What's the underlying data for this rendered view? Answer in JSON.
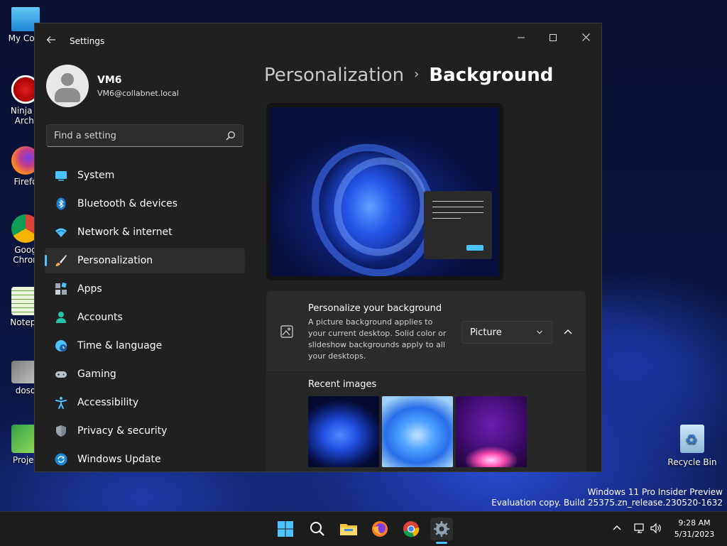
{
  "desktop": {
    "icons": [
      "My Com",
      "Ninja K\nArchi",
      "Firefo",
      "Goog\nChron",
      "Notepa",
      "doso",
      "Projec"
    ],
    "recycle_bin": "Recycle Bin",
    "watermark_line1": "Windows 11 Pro Insider Preview",
    "watermark_line2": "Evaluation copy. Build 25375.zn_release.230520-1632"
  },
  "window": {
    "title": "Settings",
    "controls": {
      "minimize": "—",
      "maximize": "☐",
      "close": "✕"
    }
  },
  "profile": {
    "name": "VM6",
    "email": "VM6@collabnet.local"
  },
  "search": {
    "placeholder": "Find a setting"
  },
  "sidebar": {
    "items": [
      {
        "label": "System",
        "icon": "monitor-icon"
      },
      {
        "label": "Bluetooth & devices",
        "icon": "bluetooth-icon"
      },
      {
        "label": "Network & internet",
        "icon": "wifi-icon"
      },
      {
        "label": "Personalization",
        "icon": "brush-icon",
        "active": true
      },
      {
        "label": "Apps",
        "icon": "apps-icon"
      },
      {
        "label": "Accounts",
        "icon": "person-icon"
      },
      {
        "label": "Time & language",
        "icon": "clock-globe-icon"
      },
      {
        "label": "Gaming",
        "icon": "gamepad-icon"
      },
      {
        "label": "Accessibility",
        "icon": "accessibility-icon"
      },
      {
        "label": "Privacy & security",
        "icon": "shield-icon"
      },
      {
        "label": "Windows Update",
        "icon": "update-icon"
      }
    ]
  },
  "breadcrumb": {
    "parent": "Personalization",
    "separator": "›",
    "current": "Background"
  },
  "background_card": {
    "title": "Personalize your background",
    "description": "A picture background applies to your current desktop. Solid color or slideshow backgrounds apply to all your desktops.",
    "dropdown_value": "Picture"
  },
  "recent": {
    "title": "Recent images"
  },
  "taskbar": {
    "time": "9:28 AM",
    "date": "5/31/2023"
  },
  "colors": {
    "accent": "#4cc2ff",
    "window_bg": "#202020",
    "card_bg": "#2b2b2b"
  }
}
